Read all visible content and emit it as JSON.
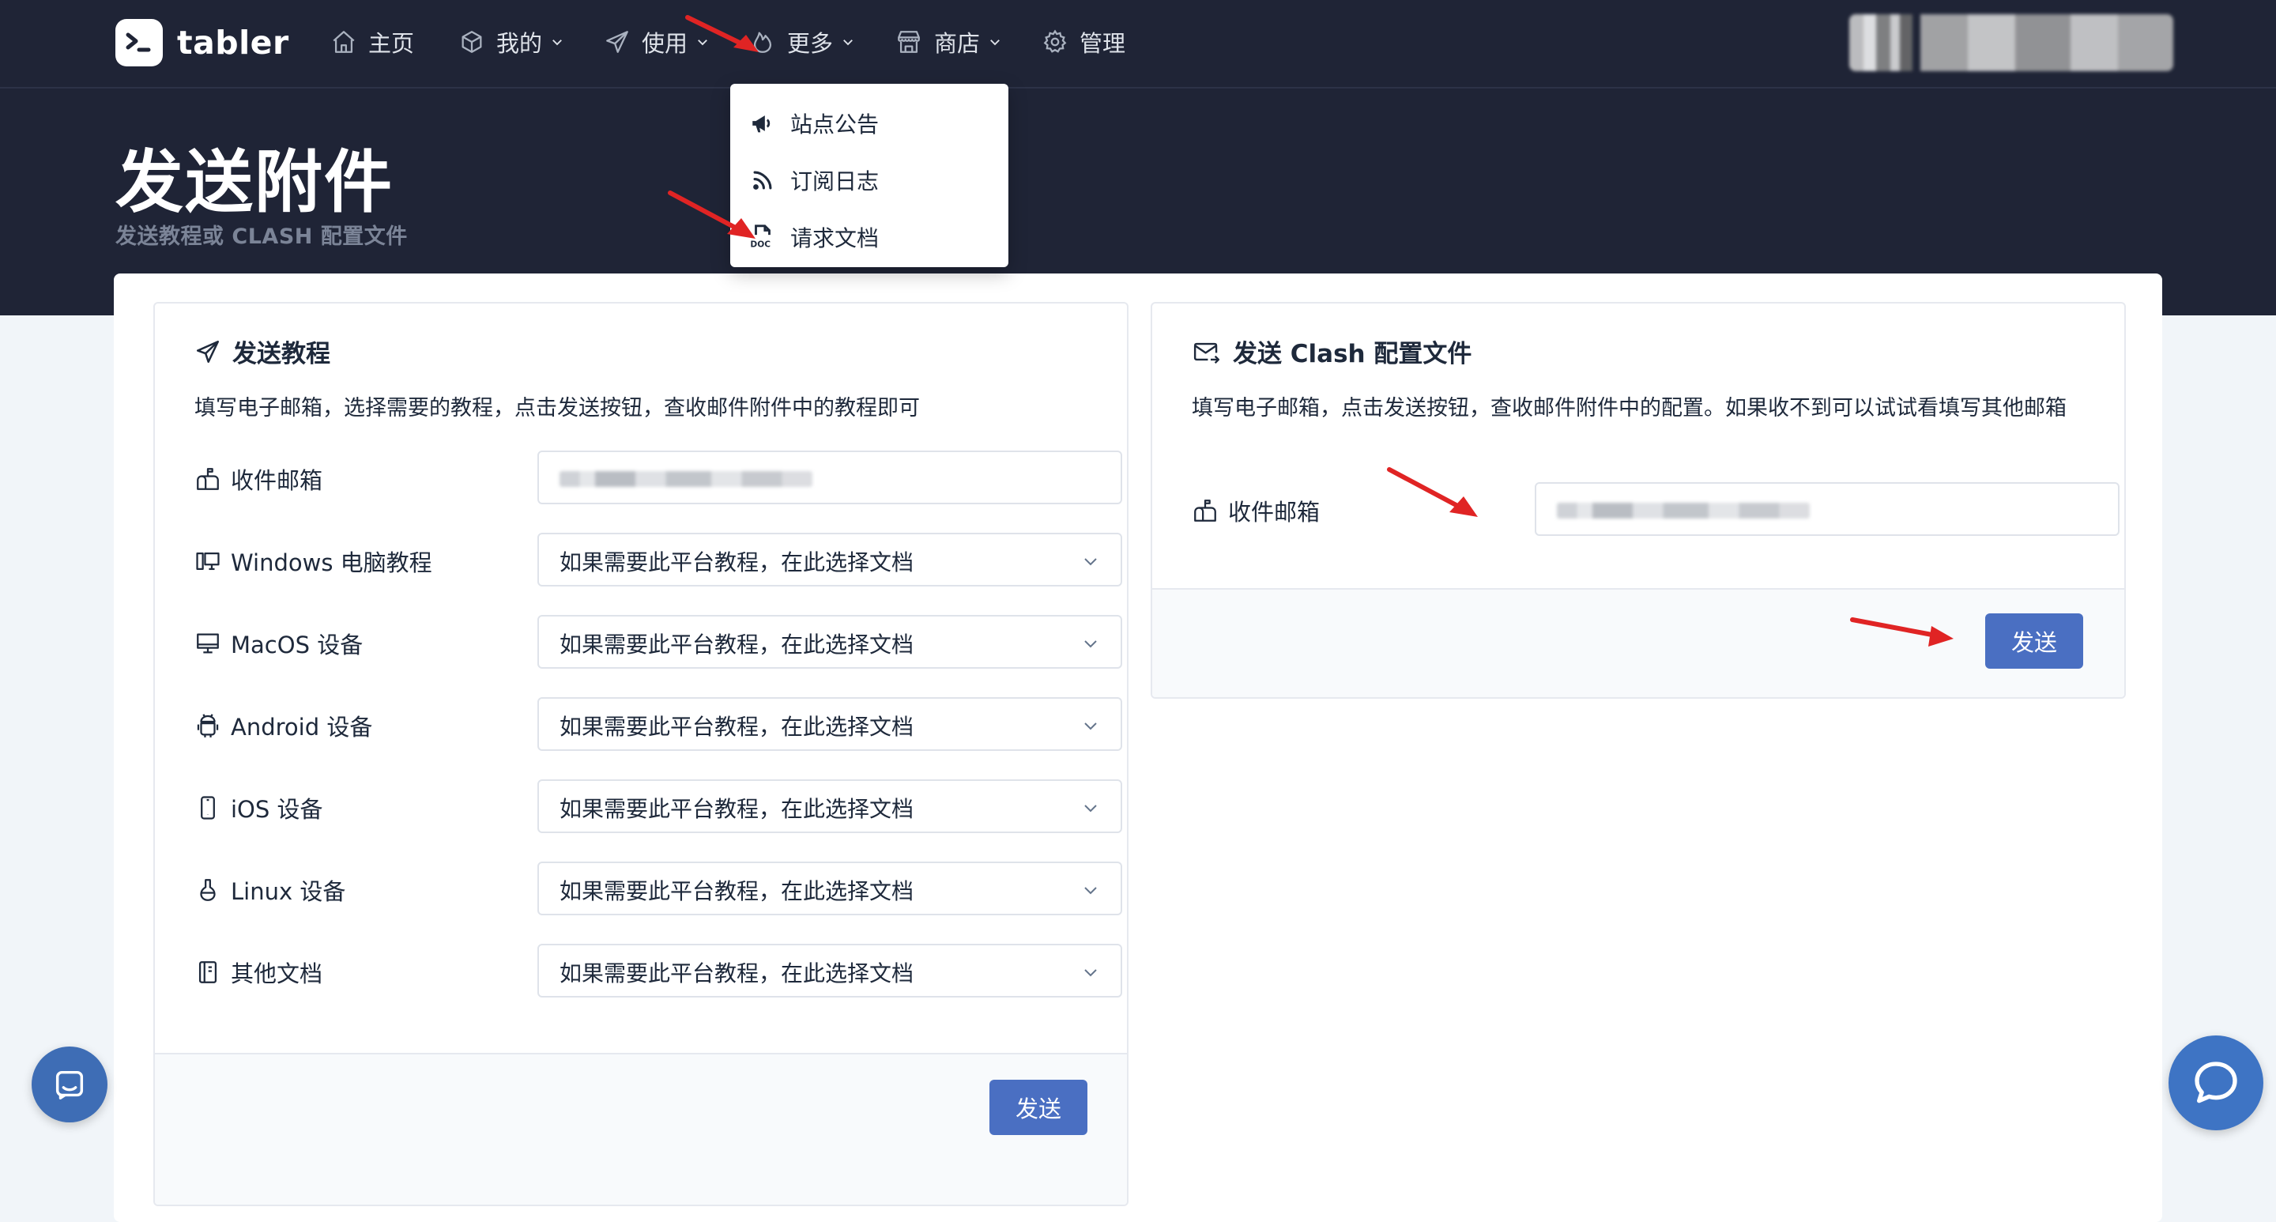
{
  "brand": {
    "name": "tabler"
  },
  "nav": {
    "home": "主页",
    "mine": "我的",
    "usage": "使用",
    "more": "更多",
    "shop": "商店",
    "admin": "管理"
  },
  "dropdown": {
    "items": [
      {
        "label": "站点公告",
        "icon": "megaphone-icon"
      },
      {
        "label": "订阅日志",
        "icon": "rss-icon"
      },
      {
        "label": "请求文档",
        "icon": "doc-file-icon"
      }
    ]
  },
  "page": {
    "title": "发送附件",
    "subtitle": "发送教程或 CLASH 配置文件"
  },
  "tutorial_card": {
    "title": "发送教程",
    "description": "填写电子邮箱，选择需要的教程，点击发送按钮，查收邮件附件中的教程即可",
    "rows": [
      {
        "label": "收件邮箱",
        "icon": "mailbox-icon",
        "value": ""
      },
      {
        "label": "Windows 电脑教程",
        "icon": "devices-pc-icon",
        "value": "如果需要此平台教程，在此选择文档"
      },
      {
        "label": "MacOS 设备",
        "icon": "device-desktop-icon",
        "value": "如果需要此平台教程，在此选择文档"
      },
      {
        "label": "Android 设备",
        "icon": "android-icon",
        "value": "如果需要此平台教程，在此选择文档"
      },
      {
        "label": "iOS 设备",
        "icon": "device-mobile-icon",
        "value": "如果需要此平台教程，在此选择文档"
      },
      {
        "label": "Linux 设备",
        "icon": "flask-icon",
        "value": "如果需要此平台教程，在此选择文档"
      },
      {
        "label": "其他文档",
        "icon": "notebook-icon",
        "value": "如果需要此平台教程，在此选择文档"
      }
    ],
    "send_label": "发送"
  },
  "clash_card": {
    "title": "发送 Clash 配置文件",
    "description": "填写电子邮箱，点击发送按钮，查收邮件附件中的配置。如果收不到可以试试看填写其他邮箱",
    "email_label": "收件邮箱",
    "send_label": "发送"
  },
  "colors": {
    "header_bg": "#1f2436",
    "primary": "#4a6fc2",
    "annotation_arrow": "#e02424"
  }
}
